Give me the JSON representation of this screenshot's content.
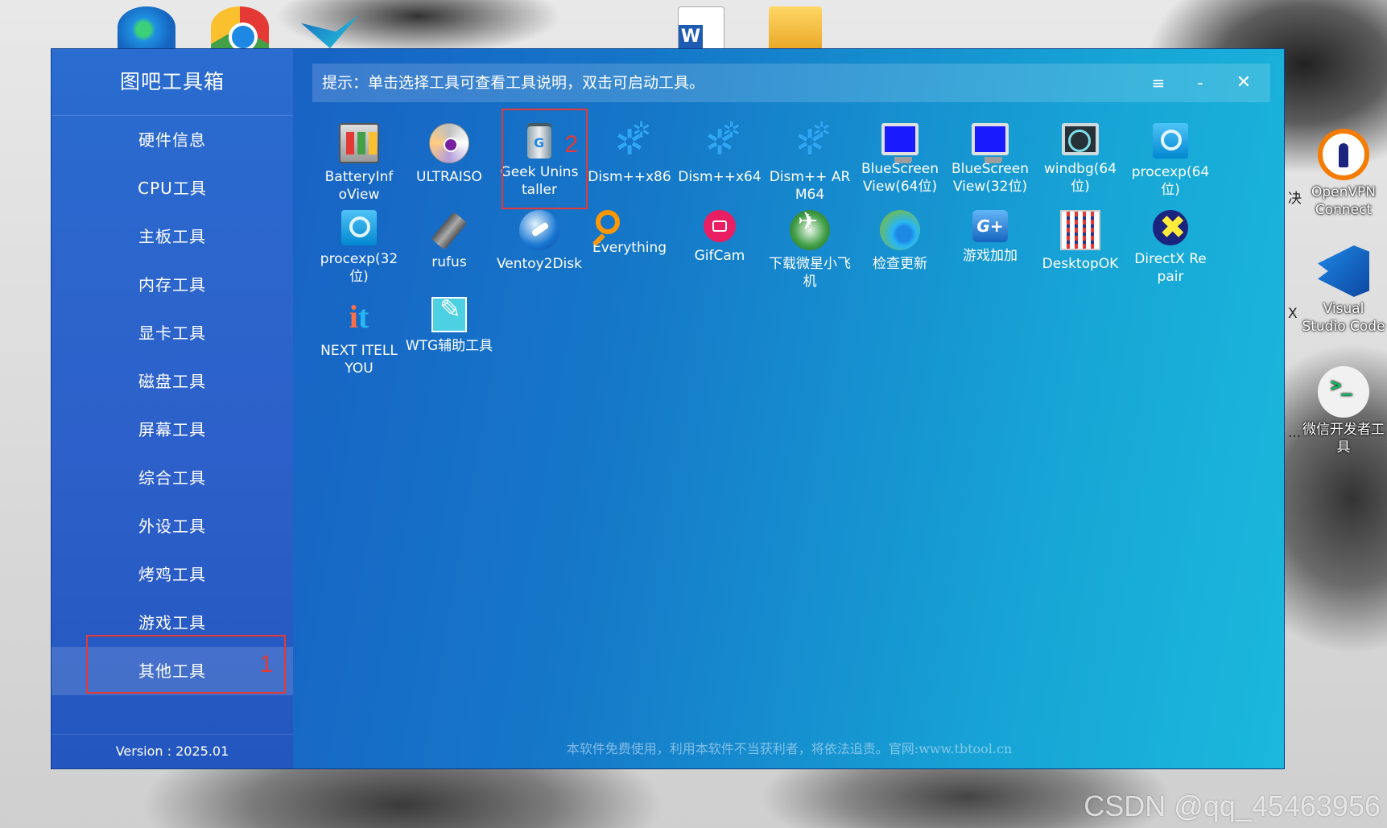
{
  "desktop": {
    "top_icons": [
      "edge-icon",
      "chrome-icon",
      "feishu-icon",
      "word-icon",
      "folder-icon"
    ],
    "side_items": [
      {
        "label": "OpenVPN Connect",
        "icon": "openvpn-icon"
      },
      {
        "label": "Visual Studio Code",
        "icon": "vscode-icon"
      },
      {
        "label": "微信开发者工具",
        "icon": "wechat-devtools-icon"
      }
    ],
    "side_fragments": [
      "决",
      "X",
      "..."
    ],
    "watermark": "CSDN @qq_45463956"
  },
  "app": {
    "title": "图吧工具箱",
    "tip": "提示：单击选择工具可查看工具说明，双击可启动工具。",
    "window_buttons": {
      "menu": "≡",
      "minimize": "-",
      "close": "✕"
    },
    "nav": [
      {
        "label": "硬件信息"
      },
      {
        "label": "CPU工具"
      },
      {
        "label": "主板工具"
      },
      {
        "label": "内存工具"
      },
      {
        "label": "显卡工具"
      },
      {
        "label": "磁盘工具"
      },
      {
        "label": "屏幕工具"
      },
      {
        "label": "综合工具"
      },
      {
        "label": "外设工具"
      },
      {
        "label": "烤鸡工具"
      },
      {
        "label": "游戏工具"
      },
      {
        "label": "其他工具",
        "active": true
      }
    ],
    "version": "Version : 2025.01",
    "tools": [
      {
        "label": "BatteryInf\noView",
        "icon": "battery-icon"
      },
      {
        "label": "ULTRAISO",
        "icon": "disc-icon"
      },
      {
        "label": "Geek Unins\ntaller",
        "icon": "trash-icon"
      },
      {
        "label": "Dism++x86",
        "icon": "gear-icon"
      },
      {
        "label": "Dism++x64",
        "icon": "gear-icon"
      },
      {
        "label": "Dism++ AR\nM64",
        "icon": "gear-icon"
      },
      {
        "label": "BlueScreen\nView(64位)",
        "icon": "monitor-icon"
      },
      {
        "label": "BlueScreen\nView(32位)",
        "icon": "monitor-icon"
      },
      {
        "label": "windbg(64位)",
        "icon": "debugger-icon"
      },
      {
        "label": "procexp(64\n位)",
        "icon": "magnifier-icon"
      },
      {
        "label": "procexp(32\n位)",
        "icon": "magnifier-icon"
      },
      {
        "label": "rufus",
        "icon": "usb-icon"
      },
      {
        "label": "Ventoy2Disk",
        "icon": "ventoy-icon"
      },
      {
        "label": "Everything",
        "icon": "search-icon"
      },
      {
        "label": "GifCam",
        "icon": "camera-icon"
      },
      {
        "label": "下载微星小飞\n机",
        "icon": "plane-icon"
      },
      {
        "label": "检查更新",
        "icon": "edge-icon"
      },
      {
        "label": "游戏加加",
        "icon": "game-icon"
      },
      {
        "label": "DesktopOK",
        "icon": "grid-icon"
      },
      {
        "label": "DirectX Re\npair",
        "icon": "directx-icon"
      },
      {
        "label": "NEXT ITELL\nYOU",
        "icon": "nextitell-icon"
      },
      {
        "label": "WTG辅助工具",
        "icon": "wtg-icon"
      }
    ],
    "footer": "本软件免费使用，利用本软件不当获利者，将依法追责。官网:www.tbtool.cn"
  },
  "annotations": {
    "box1": "1",
    "box2": "2",
    "color": "#e53935"
  }
}
